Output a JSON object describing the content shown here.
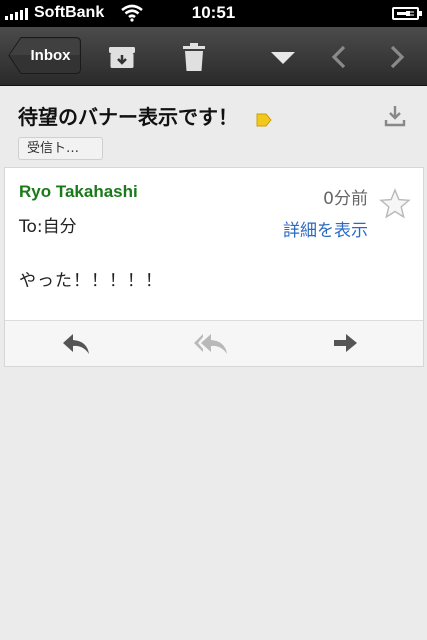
{
  "status_bar": {
    "carrier": "SoftBank",
    "time": "10:51"
  },
  "toolbar": {
    "back_label": "Inbox",
    "icons": [
      "archive-icon",
      "trash-icon",
      "dropdown-arrow-icon",
      "prev-message-icon",
      "next-message-icon"
    ]
  },
  "message": {
    "subject": "待望のバナー表示です！",
    "label_chip": "受信ト…",
    "sender": "Ryo Takahashi",
    "time_ago": "0分前",
    "to": "To:自分",
    "details_link": "詳細を表示",
    "body": "やった！！！！！"
  },
  "colors": {
    "sender": "#1a7a1a",
    "link": "#2a6bc4",
    "label_tag": "#f2c81a",
    "toolbar_bg": "#3a3a3a"
  }
}
